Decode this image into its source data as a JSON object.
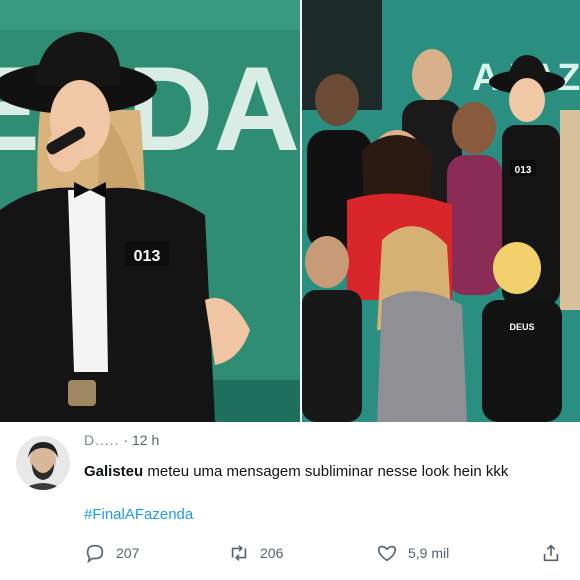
{
  "tweet": {
    "author_name_partial": "D.....",
    "separator": "· 12 h",
    "mention": "Galisteu",
    "body": " meteu uma mensagem subliminar nesse look hein kkk",
    "hashtag": "#FinalAFazenda"
  },
  "actions": {
    "replies": "207",
    "retweets": "206",
    "likes": "5,9 mil"
  },
  "media": {
    "left_backdrop_text": "ENDA",
    "right_backdrop_text": "A FAZ",
    "left_badge": "013",
    "right_badge": "013",
    "shirt_print": "DEUS"
  },
  "icons": [
    "reply-icon",
    "retweet-icon",
    "heart-icon",
    "share-icon"
  ],
  "colors": {
    "link": "#1d9bf0",
    "muted": "#536471",
    "text": "#0f1419",
    "backdrop_green": "#2f8d74"
  }
}
